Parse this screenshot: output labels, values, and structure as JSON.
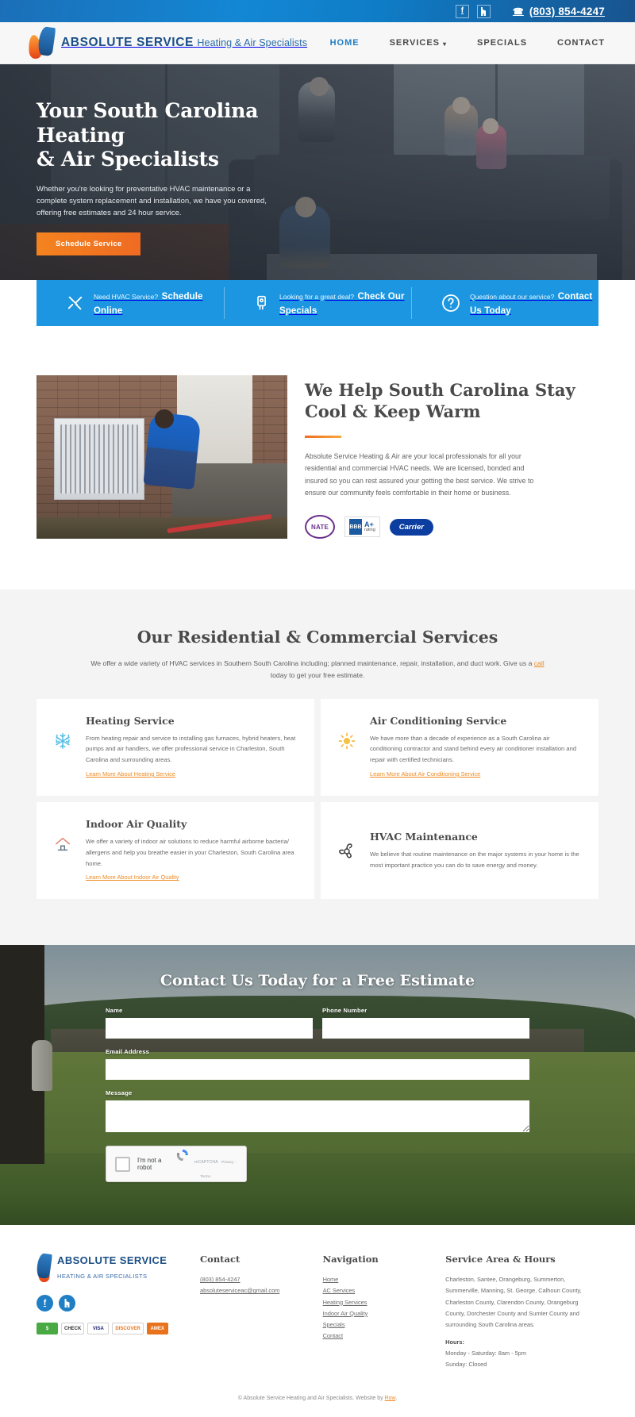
{
  "topbar": {
    "facebook_icon": "facebook-icon",
    "social2_icon": "houzz-icon",
    "phone_icon": "phone-icon",
    "phone": "(803) 854-4247"
  },
  "header": {
    "logo_icon": "flame-droplet-logo",
    "brand_line1": "ABSOLUTE SERVICE",
    "brand_line2": "Heating & Air Specialists",
    "nav": [
      {
        "label": "HOME",
        "active": true,
        "caret": ""
      },
      {
        "label": "SERVICES",
        "active": false,
        "caret": "⌄"
      },
      {
        "label": "SPECIALS",
        "active": false,
        "caret": ""
      },
      {
        "label": "CONTACT",
        "active": false,
        "caret": ""
      }
    ]
  },
  "hero": {
    "heading_line1": "Your South Carolina Heating",
    "heading_line2": "& Air Specialists",
    "paragraph": "Whether you're looking for preventative HVAC maintenance or a complete system replacement and installation, we have you covered, offering free estimates and 24 hour service.",
    "cta_label": "Schedule Service"
  },
  "cta_band": {
    "accent_color": "#1c96e0",
    "items": [
      {
        "icon": "wrench-screwdriver-icon",
        "small": "Need HVAC Service?",
        "big": "Schedule Online"
      },
      {
        "icon": "hand-tag-icon",
        "small": "Looking for a great deal?",
        "big": "Check Our Specials"
      },
      {
        "icon": "question-mark-circle-icon",
        "small": "Question about our service?",
        "big": "Contact Us Today"
      }
    ]
  },
  "about": {
    "photo_alt": "hvac-technician-servicing-outdoor-condenser-unit",
    "heading_line1": "We Help South Carolina Stay",
    "heading_line2": "Cool & Keep Warm",
    "paragraph": "Absolute Service Heating & Air are your local professionals for all your residential and commercial HVAC needs. We are licensed, bonded and insured so you can rest assured your getting the best service. We strive to ensure our community feels comfortable in their home or business.",
    "badges": [
      {
        "name": "nate-certified-badge",
        "text": "NATE"
      },
      {
        "name": "bbb-accredited-badge",
        "mark": "BBB",
        "grade": "A+",
        "sub": "rating"
      },
      {
        "name": "carrier-dealer-badge",
        "text": "Carrier"
      }
    ]
  },
  "services": {
    "heading": "Our Residential & Commercial Services",
    "intro_before": "We offer a wide variety of HVAC services in Southern South Carolina including; planned maintenance, repair, installation, and duct work. Give us a ",
    "intro_link": "call",
    "intro_after": " today to get your free estimate.",
    "cards": [
      {
        "icon": "snowflake-icon",
        "title": "Heating Service",
        "body": "From heating repair and service to installing gas furnaces, hybrid heaters, heat pumps and air handlers, we offer professional service in Charleston, South Carolina and surrounding areas.",
        "link": "Learn More About Heating Service"
      },
      {
        "icon": "sun-icon",
        "title": "Air Conditioning Service",
        "body": "We have more than a decade of experience as a South Carolina air conditioning contractor and stand behind every air conditioner installation and repair with certified technicians.",
        "link": "Learn More About Air Conditioning Service"
      },
      {
        "icon": "house-airflow-icon",
        "title": "Indoor Air Quality",
        "body": "We offer a variety of indoor air solutions to reduce harmful airborne bacteria/ allergens and help you breathe easier in your Charleston, South Carolina area home.",
        "link": "Learn More About Indoor Air Quality"
      },
      {
        "icon": "blower-motor-icon",
        "title": "HVAC Maintenance",
        "body": "We believe that routine maintenance on the major systems in your home is the most important practice you can do to save energy and money.",
        "link": ""
      }
    ]
  },
  "contact": {
    "heading": "Contact Us Today for a Free Estimate",
    "fields": {
      "name_label": "Name",
      "name_value": "",
      "phone_label": "Phone Number",
      "phone_value": "",
      "email_label": "Email Address",
      "email_value": "",
      "message_label": "Message",
      "message_value": ""
    },
    "recaptcha": {
      "label": "I'm not a robot",
      "brand": "reCAPTCHA",
      "terms": "Privacy - Terms"
    }
  },
  "footer": {
    "brand_line1": "ABSOLUTE SERVICE",
    "brand_line2": "HEATING & AIR SPECIALISTS",
    "socials": [
      {
        "icon": "facebook-icon",
        "glyph": "f"
      },
      {
        "icon": "houzz-icon",
        "glyph": "h"
      }
    ],
    "payment_methods": [
      "$",
      "CHECK",
      "VISA",
      "DISCOVER",
      "AMEX"
    ],
    "contact": {
      "heading": "Contact",
      "phone": "(803) 854-4247",
      "email": "absoluteserviceac@gmail.com"
    },
    "navigation": {
      "heading": "Navigation",
      "links": [
        "Home",
        "AC Services",
        "Heating Services",
        "Indoor Air Quality",
        "Specials",
        "Contact"
      ]
    },
    "service_area": {
      "heading": "Service Area & Hours",
      "body": "Charleston, Santee, Orangeburg, Summerton, Summerville, Manning, St. George, Calhoun County, Charleston County, Clarendon County, Orangeburg County, Dorchester County and Sumter County and surrounding South Carolina areas.",
      "hours_label": "Hours:",
      "hours_line1": "Monday - Saturday: 8am - 5pm",
      "hours_line2": "Sunday: Closed"
    },
    "copyright_before": "© Absolute Service Heating and Air Specialists. Website by ",
    "copyright_link": "Row",
    "copyright_after": "."
  }
}
